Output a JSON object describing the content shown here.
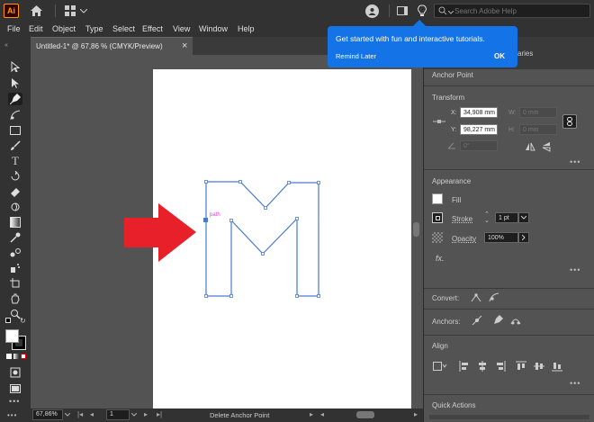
{
  "app": {
    "logo": "Ai"
  },
  "search": {
    "placeholder": "Search Adobe Help"
  },
  "menu": [
    "File",
    "Edit",
    "Object",
    "Type",
    "Select",
    "Effect",
    "View",
    "Window",
    "Help"
  ],
  "document_tab": {
    "title": "Untitled-1* @ 67,86 % (CMYK/Preview)",
    "close": "×"
  },
  "tooltip": {
    "title": "Get started with fun and interactive tutorials.",
    "remind": "Remind Later",
    "ok": "OK"
  },
  "panel": {
    "hidden_tab_fragment": "aries",
    "anchor_point": "Anchor Point",
    "transform": {
      "title": "Transform",
      "x_label": "X:",
      "x_value": "34,908 mm",
      "y_label": "Y:",
      "y_value": "98,227 mm",
      "w_label": "W:",
      "w_value": "0 mm",
      "h_label": "H:",
      "h_value": "0 mm",
      "angle_value": "0°"
    },
    "appearance": {
      "title": "Appearance",
      "fill": "Fill",
      "stroke": "Stroke",
      "stroke_value": "1 pt",
      "opacity": "Opacity",
      "opacity_value": "100%",
      "fx": "fx."
    },
    "convert": "Convert:",
    "anchors": "Anchors:",
    "align": "Align",
    "quick_actions": "Quick Actions"
  },
  "canvas": {
    "path_label": "path"
  },
  "status": {
    "zoom": "67,86%",
    "artboard": "1",
    "tool": "Delete Anchor Point"
  },
  "colors": {
    "accent": "#1473e6",
    "path": "#4a7ad0",
    "arrow": "#e8202a",
    "path_label": "#d040d0"
  }
}
